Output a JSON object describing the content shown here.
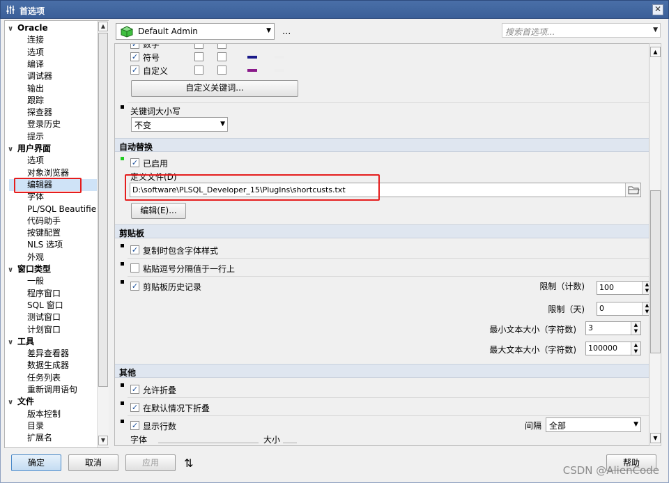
{
  "window": {
    "title": "首选项"
  },
  "tree": {
    "groups": [
      {
        "label": "Oracle",
        "items": [
          "连接",
          "选项",
          "编译",
          "调试器",
          "输出",
          "跟踪",
          "探查器",
          "登录历史",
          "提示"
        ]
      },
      {
        "label": "用户界面",
        "items": [
          "选项",
          "对象浏览器",
          "编辑器",
          "字体",
          "PL/SQL Beautifier",
          "代码助手",
          "按键配置",
          "NLS 选项",
          "外观"
        ]
      },
      {
        "label": "窗口类型",
        "items": [
          "一般",
          "程序窗口",
          "SQL 窗口",
          "测试窗口",
          "计划窗口"
        ]
      },
      {
        "label": "工具",
        "items": [
          "差异查看器",
          "数据生成器",
          "任务列表",
          "重新调用语句"
        ]
      },
      {
        "label": "文件",
        "items": [
          "版本控制",
          "目录",
          "扩展名"
        ]
      }
    ]
  },
  "header": {
    "profile": "Default Admin",
    "more": "...",
    "search_placeholder": "搜索首选项..."
  },
  "highlight": {
    "rows": [
      {
        "label": "符号",
        "color": "#1a1a8a"
      },
      {
        "label": "自定义",
        "color": "#8a1a8a"
      }
    ],
    "partial_label": "数字",
    "custom_keywords_button": "自定义关键词..."
  },
  "keyword_case": {
    "label": "关键词大小写",
    "value": "不变"
  },
  "autoreplace": {
    "title": "自动替换",
    "enabled_label": "已启用",
    "file_label": "定义文件(D)",
    "file_path": "D:\\software\\PLSQL_Developer_15\\PlugIns\\shortcusts.txt",
    "edit_button": "编辑(E)..."
  },
  "clipboard": {
    "title": "剪贴板",
    "copy_font_label": "复制时包含字体样式",
    "paste_comma_label": "粘贴逗号分隔值于一行上",
    "history_label": "剪贴板历史记录",
    "limit_count_label": "限制（计数)",
    "limit_count": "100",
    "limit_days_label": "限制（天)",
    "limit_days": "0",
    "min_size_label": "最小文本大小（字符数)",
    "min_size": "3",
    "max_size_label": "最大文本大小（字符数)",
    "max_size": "100000"
  },
  "other": {
    "title": "其他",
    "allow_fold": "允许折叠",
    "fold_default": "在默认情况下折叠",
    "show_lines": "显示行数",
    "interval_label": "间隔",
    "interval_value": "全部",
    "font_label": "字体",
    "size_label": "大小"
  },
  "footer": {
    "ok": "确定",
    "cancel": "取消",
    "apply": "应用",
    "help": "帮助"
  },
  "watermark": "CSDN @AlienCode"
}
